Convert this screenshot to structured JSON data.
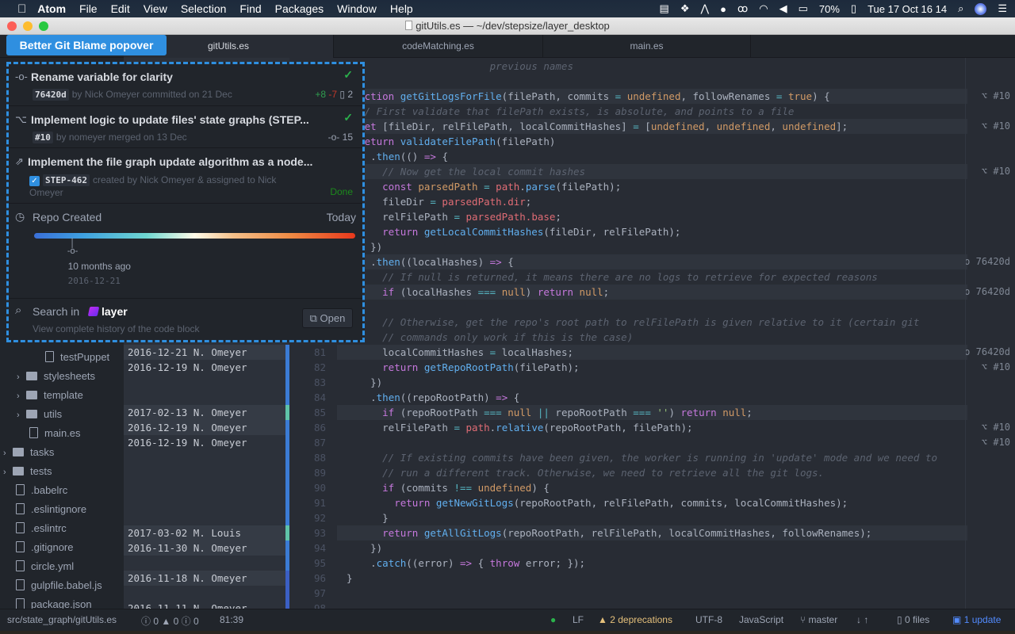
{
  "menubar": {
    "app": "Atom",
    "items": [
      "File",
      "Edit",
      "View",
      "Selection",
      "Find",
      "Packages",
      "Window",
      "Help"
    ],
    "battery": "70%",
    "clock": "Tue 17 Oct  16 14"
  },
  "window": {
    "title": "gitUtils.es — ~/dev/stepsize/layer_desktop"
  },
  "overlay_label": "Better Git Blame popover",
  "tabs": [
    {
      "label": "gitUtils.es",
      "active": true
    },
    {
      "label": "codeMatching.es",
      "active": false
    },
    {
      "label": "main.es",
      "active": false
    }
  ],
  "tree": [
    {
      "label": "testPuppet",
      "type": "file",
      "depth": 3
    },
    {
      "label": "stylesheets",
      "type": "folder",
      "depth": 2
    },
    {
      "label": "template",
      "type": "folder",
      "depth": 2
    },
    {
      "label": "utils",
      "type": "folder",
      "depth": 2
    },
    {
      "label": "main.es",
      "type": "file",
      "depth": 2
    },
    {
      "label": "tasks",
      "type": "folder",
      "depth": 1
    },
    {
      "label": "tests",
      "type": "folder",
      "depth": 1
    },
    {
      "label": ".babelrc",
      "type": "file",
      "depth": 1
    },
    {
      "label": ".eslintignore",
      "type": "file",
      "depth": 1
    },
    {
      "label": ".eslintrc",
      "type": "file",
      "depth": 1
    },
    {
      "label": ".gitignore",
      "type": "file",
      "depth": 1
    },
    {
      "label": "circle.yml",
      "type": "file",
      "depth": 1
    },
    {
      "label": "gulpfile.babel.js",
      "type": "file",
      "depth": 1
    },
    {
      "label": "package.json",
      "type": "file",
      "depth": 1
    }
  ],
  "blame": [
    {
      "line": 81,
      "text": "2016-12-21 N. Omeyer",
      "color": "#3b7bd4",
      "active": true
    },
    {
      "line": 82,
      "text": "2016-12-19 N. Omeyer",
      "color": "#3b7bd4"
    },
    {
      "line": 83,
      "text": "",
      "color": "#3b7bd4"
    },
    {
      "line": 84,
      "text": "",
      "color": "#3b7bd4"
    },
    {
      "line": 85,
      "text": "2017-02-13 N. Omeyer",
      "color": "#5fc3a8",
      "active": true
    },
    {
      "line": 86,
      "text": "2016-12-19 N. Omeyer",
      "color": "#3b7bd4",
      "active": true
    },
    {
      "line": 87,
      "text": "2016-12-19 N. Omeyer",
      "color": "#3b7bd4"
    },
    {
      "line": 88,
      "text": "",
      "color": "#3b7bd4"
    },
    {
      "line": 89,
      "text": "",
      "color": "#3b7bd4"
    },
    {
      "line": 90,
      "text": "",
      "color": "#3b7bd4"
    },
    {
      "line": 91,
      "text": "",
      "color": "#3b7bd4"
    },
    {
      "line": 92,
      "text": "",
      "color": "#3b7bd4"
    },
    {
      "line": 93,
      "text": "2017-03-02 M. Louis",
      "color": "#5fc3a8",
      "active": true
    },
    {
      "line": 94,
      "text": "2016-11-30 N. Omeyer",
      "color": "#3b7bd4",
      "active": true
    },
    {
      "line": 95,
      "text": "",
      "color": "#3b7bd4"
    },
    {
      "line": 96,
      "text": "2016-11-18 N. Omeyer",
      "color": "#3b5fc4",
      "active": true
    },
    {
      "line": 97,
      "text": "",
      "color": "#3b5fc4"
    },
    {
      "line": 98,
      "text": "2016-11-11 N. Omeyer",
      "color": "#3b5fc4"
    }
  ],
  "code": {
    "first_line": 62,
    "highlighted": [
      64,
      66,
      69,
      75,
      77,
      81,
      85,
      93
    ],
    "lines": [
      [
        [
          "c",
          "                        previous names"
        ]
      ],
      [],
      [
        [
          "k",
          "function "
        ],
        [
          "f",
          "getGitLogsForFile"
        ],
        [
          "p",
          "(filePath, commits "
        ],
        [
          "o",
          "="
        ],
        [
          "p",
          " "
        ],
        [
          "n",
          "undefined"
        ],
        [
          "p",
          ", followRenames "
        ],
        [
          "o",
          "="
        ],
        [
          "p",
          " "
        ],
        [
          "n",
          "true"
        ],
        [
          "p",
          ") {"
        ]
      ],
      [
        [
          "c",
          "  // First validate that filePath exists, is absolute, and points to a file"
        ]
      ],
      [
        [
          "k",
          "  let "
        ],
        [
          "p",
          "[fileDir, relFilePath, localCommitHashes] "
        ],
        [
          "o",
          "="
        ],
        [
          "p",
          " ["
        ],
        [
          "n",
          "undefined"
        ],
        [
          "p",
          ", "
        ],
        [
          "n",
          "undefined"
        ],
        [
          "p",
          ", "
        ],
        [
          "n",
          "undefined"
        ],
        [
          "p",
          "];"
        ]
      ],
      [
        [
          "k",
          "  return "
        ],
        [
          "f",
          "validateFilePath"
        ],
        [
          "p",
          "(filePath)"
        ]
      ],
      [
        [
          "p",
          "    ."
        ],
        [
          "f",
          "then"
        ],
        [
          "p",
          "(() "
        ],
        [
          "k",
          "=>"
        ],
        [
          "p",
          " {"
        ]
      ],
      [
        [
          "c",
          "      // Now get the local commit hashes"
        ]
      ],
      [
        [
          "k",
          "      const "
        ],
        [
          "n",
          "parsedPath"
        ],
        [
          "p",
          " "
        ],
        [
          "o",
          "="
        ],
        [
          "p",
          " "
        ],
        [
          "v",
          "path"
        ],
        [
          "p",
          "."
        ],
        [
          "f",
          "parse"
        ],
        [
          "p",
          "(filePath);"
        ]
      ],
      [
        [
          "p",
          "      fileDir "
        ],
        [
          "o",
          "="
        ],
        [
          "p",
          " "
        ],
        [
          "v",
          "parsedPath.dir"
        ],
        [
          "p",
          ";"
        ]
      ],
      [
        [
          "p",
          "      relFilePath "
        ],
        [
          "o",
          "="
        ],
        [
          "p",
          " "
        ],
        [
          "v",
          "parsedPath.base"
        ],
        [
          "p",
          ";"
        ]
      ],
      [
        [
          "k",
          "      return "
        ],
        [
          "f",
          "getLocalCommitHashes"
        ],
        [
          "p",
          "(fileDir, relFilePath);"
        ]
      ],
      [
        [
          "p",
          "    })"
        ]
      ],
      [
        [
          "p",
          "    ."
        ],
        [
          "f",
          "then"
        ],
        [
          "p",
          "((localHashes) "
        ],
        [
          "k",
          "=>"
        ],
        [
          "p",
          " {"
        ]
      ],
      [
        [
          "c",
          "      // If null is returned, it means there are no logs to retrieve for expected reasons"
        ]
      ],
      [
        [
          "k",
          "      if "
        ],
        [
          "p",
          "(localHashes "
        ],
        [
          "o",
          "==="
        ],
        [
          "p",
          " "
        ],
        [
          "n",
          "null"
        ],
        [
          "p",
          ") "
        ],
        [
          "k",
          "return "
        ],
        [
          "n",
          "null"
        ],
        [
          "p",
          ";"
        ]
      ],
      [],
      [
        [
          "c",
          "      // Otherwise, get the repo's root path to relFilePath is given relative to it (certain git"
        ]
      ],
      [
        [
          "c",
          "      // commands only work if this is the case)"
        ]
      ],
      [
        [
          "p",
          "      localCommitHashes "
        ],
        [
          "o",
          "="
        ],
        [
          "p",
          " localHashes;"
        ]
      ],
      [
        [
          "k",
          "      return "
        ],
        [
          "f",
          "getRepoRootPath"
        ],
        [
          "p",
          "(filePath);"
        ]
      ],
      [
        [
          "p",
          "    })"
        ]
      ],
      [
        [
          "p",
          "    ."
        ],
        [
          "f",
          "then"
        ],
        [
          "p",
          "((repoRootPath) "
        ],
        [
          "k",
          "=>"
        ],
        [
          "p",
          " {"
        ]
      ],
      [
        [
          "k",
          "      if "
        ],
        [
          "p",
          "(repoRootPath "
        ],
        [
          "o",
          "==="
        ],
        [
          "p",
          " "
        ],
        [
          "n",
          "null"
        ],
        [
          "p",
          " "
        ],
        [
          "o",
          "||"
        ],
        [
          "p",
          " repoRootPath "
        ],
        [
          "o",
          "==="
        ],
        [
          "p",
          " "
        ],
        [
          "s",
          "''"
        ],
        [
          "p",
          ") "
        ],
        [
          "k",
          "return "
        ],
        [
          "n",
          "null"
        ],
        [
          "p",
          ";"
        ]
      ],
      [
        [
          "p",
          "      relFilePath "
        ],
        [
          "o",
          "="
        ],
        [
          "p",
          " "
        ],
        [
          "v",
          "path"
        ],
        [
          "p",
          "."
        ],
        [
          "f",
          "relative"
        ],
        [
          "p",
          "(repoRootPath, filePath);"
        ]
      ],
      [],
      [
        [
          "c",
          "      // If existing commits have been given, the worker is running in 'update' mode and we need to"
        ]
      ],
      [
        [
          "c",
          "      // run a different track. Otherwise, we need to retrieve all the git logs."
        ]
      ],
      [
        [
          "k",
          "      if "
        ],
        [
          "p",
          "(commits "
        ],
        [
          "o",
          "!=="
        ],
        [
          "p",
          " "
        ],
        [
          "n",
          "undefined"
        ],
        [
          "p",
          ") {"
        ]
      ],
      [
        [
          "k",
          "        return "
        ],
        [
          "f",
          "getNewGitLogs"
        ],
        [
          "p",
          "(repoRootPath, relFilePath, commits, localCommitHashes);"
        ]
      ],
      [
        [
          "p",
          "      }"
        ]
      ],
      [
        [
          "k",
          "      return "
        ],
        [
          "f",
          "getAllGitLogs"
        ],
        [
          "p",
          "(repoRootPath, relFilePath, localCommitHashes, followRenames);"
        ]
      ],
      [
        [
          "p",
          "    })"
        ]
      ],
      [
        [
          "p",
          "    ."
        ],
        [
          "f",
          "catch"
        ],
        [
          "p",
          "((error) "
        ],
        [
          "k",
          "=>"
        ],
        [
          "p",
          " { "
        ],
        [
          "k",
          "throw"
        ],
        [
          "p",
          " error; });"
        ]
      ],
      [
        [
          "p",
          "}"
        ]
      ],
      [],
      []
    ]
  },
  "annotations": [
    {
      "line": 64,
      "icon": "pull-request-icon",
      "text": "#10"
    },
    {
      "line": 66,
      "icon": "pull-request-icon",
      "text": "#10"
    },
    {
      "line": 69,
      "icon": "pull-request-icon",
      "text": "#10"
    },
    {
      "line": 75,
      "icon": "commit-icon",
      "text": "76420d"
    },
    {
      "line": 77,
      "icon": "commit-icon",
      "text": "76420d"
    },
    {
      "line": 81,
      "icon": "commit-icon",
      "text": "76420d"
    },
    {
      "line": 82,
      "icon": "pull-request-icon",
      "text": "#10"
    },
    {
      "line": 86,
      "icon": "pull-request-icon",
      "text": "#10"
    },
    {
      "line": 87,
      "icon": "pull-request-icon",
      "text": "#10"
    }
  ],
  "popover": {
    "commit": {
      "title": "Rename variable for clarity",
      "hash": "76420d",
      "meta": "by Nick Omeyer committed on 21 Dec",
      "additions": "+8",
      "deletions": "-7",
      "files": "2"
    },
    "pr": {
      "title": "Implement logic to update files' state graphs (STEP...",
      "number": "#10",
      "meta": "by nomeyer merged on 13 Dec",
      "commits": "15"
    },
    "issue": {
      "title": "Implement the file graph update algorithm as a node...",
      "key": "STEP-462",
      "meta": "created by Nick Omeyer & assigned to Nick",
      "meta2": "Omeyer",
      "status": "Done"
    },
    "timeline": {
      "start_label": "Repo Created",
      "end_label": "Today",
      "marker_position": 0.12,
      "marker_relative": "10 months ago",
      "marker_date": "2016-12-21"
    },
    "search": {
      "label": "Search in",
      "brand": "layer",
      "sub": "View complete history of the code block",
      "open": "Open"
    }
  },
  "statusbar": {
    "path": "src/state_graph/gitUtils.es",
    "errors": "0",
    "warnings": "0",
    "infos": "0",
    "cursor": "81:39",
    "line_ending": "LF",
    "deprecations": "2 deprecations",
    "encoding": "UTF-8",
    "grammar": "JavaScript",
    "branch": "master",
    "files": "0 files",
    "update": "1 update"
  }
}
